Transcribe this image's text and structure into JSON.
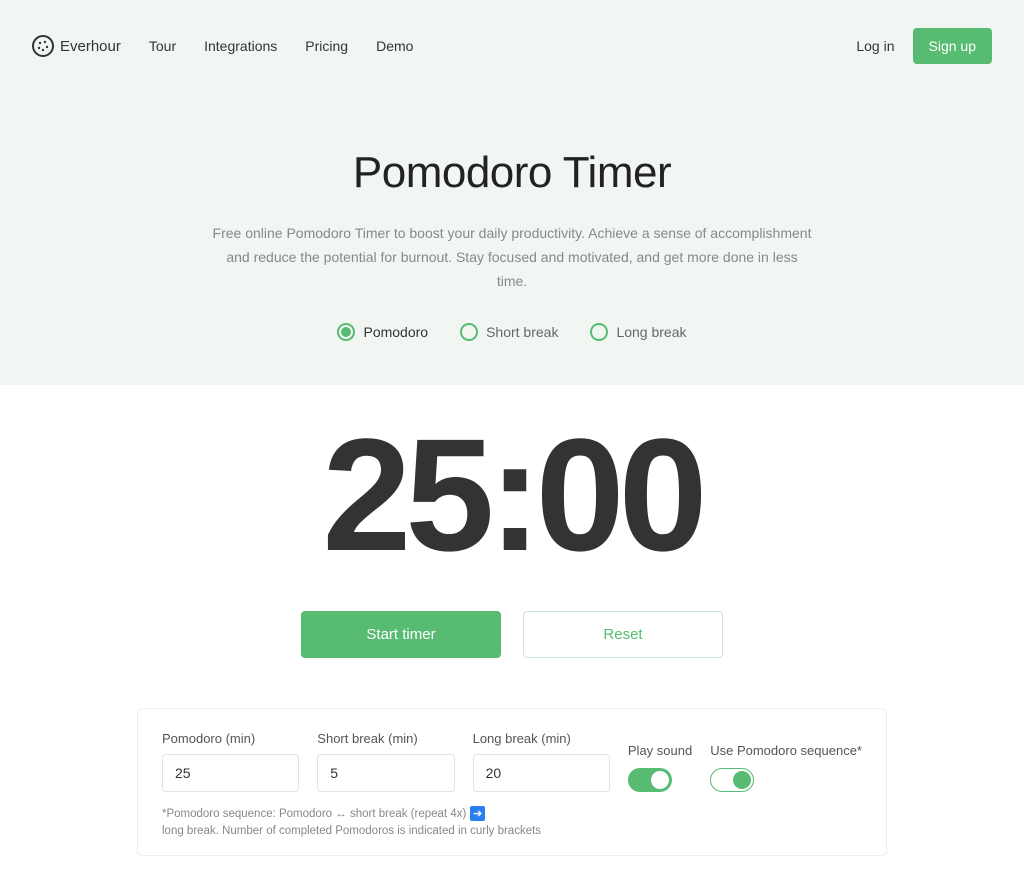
{
  "brand": "Everhour",
  "nav": {
    "tour": "Tour",
    "integrations": "Integrations",
    "pricing": "Pricing",
    "demo": "Demo"
  },
  "auth": {
    "login": "Log in",
    "signup": "Sign up"
  },
  "hero": {
    "title": "Pomodoro Timer",
    "subtitle": "Free online Pomodoro Timer to boost your daily productivity. Achieve a sense of accomplishment and reduce the potential for burnout. Stay focused and motivated, and get more done in less time."
  },
  "modes": {
    "pomodoro": "Pomodoro",
    "short_break": "Short break",
    "long_break": "Long break"
  },
  "timer": {
    "display": "25:00",
    "start": "Start timer",
    "reset": "Reset"
  },
  "settings": {
    "pomodoro_label": "Pomodoro (min)",
    "pomodoro_value": "25",
    "short_label": "Short break (min)",
    "short_value": "5",
    "long_label": "Long break (min)",
    "long_value": "20",
    "play_sound": "Play sound",
    "use_sequence": "Use Pomodoro sequence*",
    "footnote_a": "*Pomodoro sequence: Pomodoro ↔ short break (repeat 4x)",
    "footnote_b": "long break. Number of completed Pomodoros is indicated in curly brackets"
  },
  "colors": {
    "accent": "#57bb71"
  }
}
